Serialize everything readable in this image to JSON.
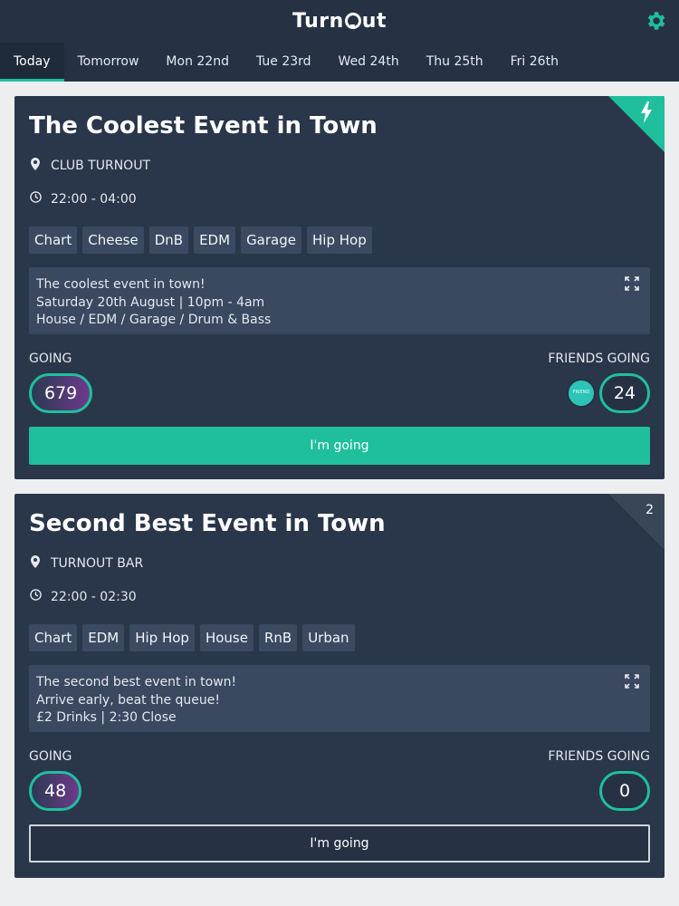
{
  "app": {
    "brand_prefix": "Turn",
    "brand_suffix": "ut",
    "accent_color": "#1fbf9d",
    "settings_icon": "gear-icon"
  },
  "tabs": [
    {
      "label": "Today",
      "active": true
    },
    {
      "label": "Tomorrow",
      "active": false
    },
    {
      "label": "Mon 22nd",
      "active": false
    },
    {
      "label": "Tue 23rd",
      "active": false
    },
    {
      "label": "Wed 24th",
      "active": false
    },
    {
      "label": "Thu 25th",
      "active": false
    },
    {
      "label": "Fri 26th",
      "active": false
    }
  ],
  "events": [
    {
      "title": "The Coolest Event in Town",
      "venue": "CLUB TURNOUT",
      "time": "22:00 - 04:00",
      "tags": [
        "Chart",
        "Cheese",
        "DnB",
        "EDM",
        "Garage",
        "Hip Hop"
      ],
      "description": [
        "The coolest event in town!",
        "Saturday 20th August | 10pm - 4am",
        "House / EDM / Garage / Drum & Bass"
      ],
      "going_label": "GOING",
      "going_count": "679",
      "friends_label": "FRIENDS GOING",
      "friends_count": "24",
      "button_label": "I'm going",
      "corner_badge": "bolt-icon"
    },
    {
      "title": "Second Best Event in Town",
      "venue": "TURNOUT BAR",
      "time": "22:00 - 02:30",
      "tags": [
        "Chart",
        "EDM",
        "Hip Hop",
        "House",
        "RnB",
        "Urban"
      ],
      "description": [
        "The second best event in town!",
        "Arrive early, beat the queue!",
        "£2 Drinks | 2:30 Close"
      ],
      "going_label": "GOING",
      "going_count": "48",
      "friends_label": "FRIENDS GOING",
      "friends_count": "0",
      "button_label": "I'm going",
      "corner_badge": "2"
    }
  ]
}
